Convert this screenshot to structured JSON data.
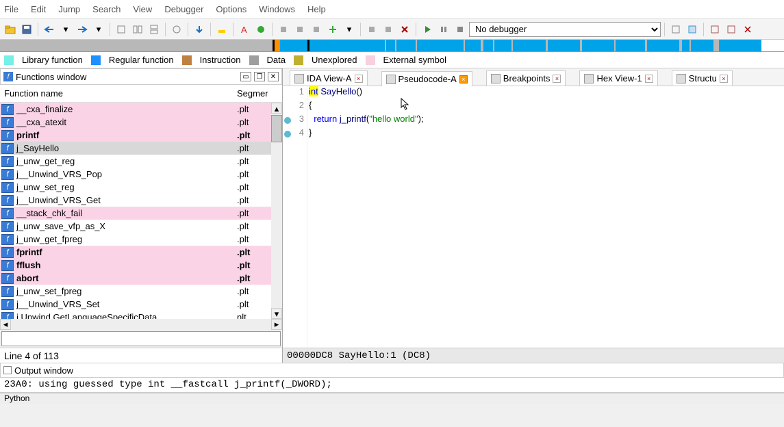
{
  "menu": [
    "File",
    "Edit",
    "Jump",
    "Search",
    "View",
    "Debugger",
    "Options",
    "Windows",
    "Help"
  ],
  "debugger_select": "No debugger",
  "legend": [
    {
      "color": "#73f0e8",
      "label": "Library function"
    },
    {
      "color": "#1e90ff",
      "label": "Regular function"
    },
    {
      "color": "#c08040",
      "label": "Instruction"
    },
    {
      "color": "#9e9e9e",
      "label": "Data"
    },
    {
      "color": "#c0b030",
      "label": "Unexplored"
    },
    {
      "color": "#f8d0e0",
      "label": "External symbol"
    }
  ],
  "functions_window": {
    "title": "Functions window",
    "columns": [
      "Function name",
      "Segmer"
    ],
    "rows": [
      {
        "name": "__cxa_finalize",
        "seg": ".plt",
        "pink": true
      },
      {
        "name": "__cxa_atexit",
        "seg": ".plt",
        "pink": true
      },
      {
        "name": "printf",
        "seg": ".plt",
        "pink": true,
        "bold": true
      },
      {
        "name": "j_SayHello",
        "seg": ".plt",
        "sel": true
      },
      {
        "name": "j_unw_get_reg",
        "seg": ".plt"
      },
      {
        "name": "j__Unwind_VRS_Pop",
        "seg": ".plt"
      },
      {
        "name": "j_unw_set_reg",
        "seg": ".plt"
      },
      {
        "name": "j__Unwind_VRS_Get",
        "seg": ".plt"
      },
      {
        "name": "__stack_chk_fail",
        "seg": ".plt",
        "pink": true
      },
      {
        "name": "j_unw_save_vfp_as_X",
        "seg": ".plt"
      },
      {
        "name": "j_unw_get_fpreg",
        "seg": ".plt"
      },
      {
        "name": "fprintf",
        "seg": ".plt",
        "pink": true,
        "bold": true
      },
      {
        "name": "fflush",
        "seg": ".plt",
        "pink": true,
        "bold": true
      },
      {
        "name": "abort",
        "seg": ".plt",
        "pink": true,
        "bold": true
      },
      {
        "name": "j_unw_set_fpreg",
        "seg": ".plt"
      },
      {
        "name": "j__Unwind_VRS_Set",
        "seg": ".plt"
      },
      {
        "name": "i  Unwind GetLanguageSpecificData",
        "seg": " nlt"
      }
    ],
    "status": "Line 4 of 113"
  },
  "tabs": [
    {
      "label": "IDA View-A"
    },
    {
      "label": "Pseudocode-A",
      "active": true,
      "orange_x": true
    },
    {
      "label": "Breakpoints"
    },
    {
      "label": "Hex View-1"
    },
    {
      "label": "Structu"
    }
  ],
  "code": {
    "lines": [
      {
        "n": 1,
        "html": "<span class='hl'><span class='kw'>int</span></span> <span class='fn'>SayHello</span>()"
      },
      {
        "n": 2,
        "html": "{"
      },
      {
        "n": 3,
        "html": "  <span class='kw'>return</span> <span class='fn'>j_printf</span>(<span class='str'>\"hello world\"</span>);",
        "bp": true
      },
      {
        "n": 4,
        "html": "}",
        "bp": true
      }
    ],
    "status": "00000DC8 SayHello:1 (DC8)"
  },
  "output": {
    "title": "Output window",
    "line": "23A0: using guessed type int __fastcall j_printf(_DWORD);"
  },
  "bottom_tab": "Python"
}
